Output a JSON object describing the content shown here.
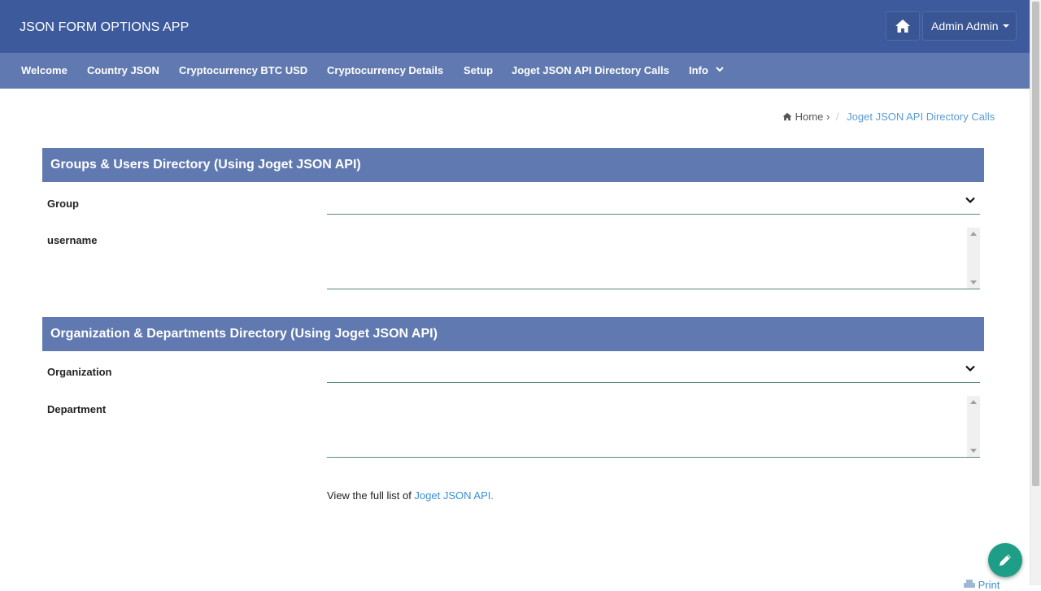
{
  "app": {
    "title": "JSON FORM OPTIONS APP"
  },
  "header": {
    "user_label": "Admin Admin",
    "home_icon": "home-icon"
  },
  "nav": {
    "items": [
      {
        "label": "Welcome"
      },
      {
        "label": "Country JSON"
      },
      {
        "label": "Cryptocurrency BTC USD"
      },
      {
        "label": "Cryptocurrency Details"
      },
      {
        "label": "Setup"
      },
      {
        "label": "Joget JSON API Directory Calls"
      },
      {
        "label": "Info"
      }
    ]
  },
  "breadcrumb": {
    "home": "Home",
    "separator": "/",
    "current": "Joget JSON API Directory Calls"
  },
  "sections": [
    {
      "title": "Groups & Users Directory (Using Joget JSON API)",
      "fields": [
        {
          "label": "Group",
          "type": "select",
          "value": ""
        },
        {
          "label": "username",
          "type": "multiselect",
          "value": ""
        }
      ]
    },
    {
      "title": "Organization & Departments Directory (Using Joget JSON API)",
      "fields": [
        {
          "label": "Organization",
          "type": "select",
          "value": ""
        },
        {
          "label": "Department",
          "type": "multiselect",
          "value": ""
        }
      ]
    }
  ],
  "footer": {
    "text": "View the full list of ",
    "link": "Joget JSON API."
  },
  "print_label": "Print",
  "colors": {
    "topbar": "#3d5a9c",
    "navbar": "#6079b0",
    "accent_link": "#3a8fd6",
    "fab": "#1e9e86"
  }
}
